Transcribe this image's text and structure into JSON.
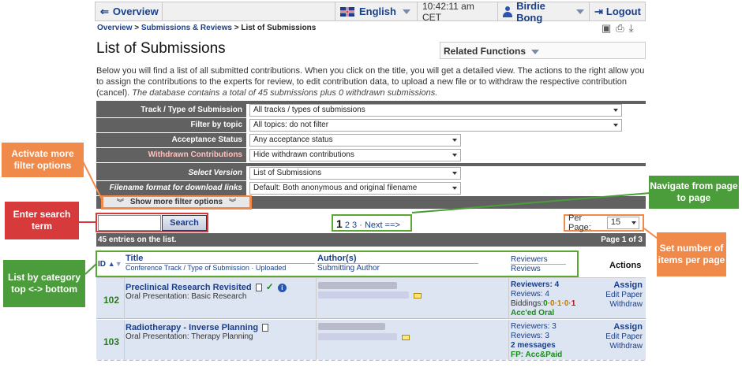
{
  "topbar": {
    "overview": "Overview",
    "language": "English",
    "time": "10:42:11 am CET",
    "user": "Birdie Bong",
    "logout": "Logout"
  },
  "breadcrumb": {
    "overview": "Overview",
    "submissions": "Submissions & Reviews",
    "current": "List of Submissions"
  },
  "page": {
    "title": "List of Submissions",
    "related_functions": "Related Functions",
    "intro": "Below you will find a list of all submitted contributions. When you click on the title, you will get a detailed view. The actions to the right allow you to assign the contributions to the experts for review, to edit contribution data, to upload a new file or to withdraw the respective contribution (cancel).",
    "intro_italic": "The database contains a total of 45 submissions plus 0 withdrawn submissions."
  },
  "filters": {
    "track_label": "Track / Type of Submission",
    "track_value": "All tracks / types of submissions",
    "topic_label": "Filter by topic",
    "topic_value": "All topics: do not filter",
    "acceptance_label": "Acceptance Status",
    "acceptance_value": "Any acceptance status",
    "withdrawn_label": "Withdrawn Contributions",
    "withdrawn_value": "Hide withdrawn contributions",
    "version_label": "Select Version",
    "version_value": "List of Submissions",
    "filename_label": "Filename format for download links",
    "filename_value": "Default: Both anonymous and original filename",
    "more_options": "Show more filter options"
  },
  "search": {
    "button": "Search",
    "value": ""
  },
  "pager": {
    "current": "1",
    "p2": "2",
    "p3": "3",
    "next": "· Next ==>"
  },
  "perpage": {
    "label": "Per Page:",
    "value": "15"
  },
  "list": {
    "entries": "45 entries on the list.",
    "page_of": "Page 1 of 3"
  },
  "table_header": {
    "id": "ID",
    "title": "Title",
    "title_sub": "Conference Track / Type of Submission · Uploaded",
    "authors": "Author(s)",
    "authors_sub": "Submitting Author",
    "reviewers": "Reviewers",
    "reviews": "Reviews",
    "actions": "Actions"
  },
  "rows": [
    {
      "id": "102",
      "title": "Preclinical Research Revisited",
      "track": "Oral Presentation: Basic Research",
      "reviewers": "Reviewers: 4",
      "reviews": "Reviews: 4",
      "biddings_label": "Biddings:",
      "biddings_a": "0",
      "biddings_b": "·0·1·0·",
      "biddings_c": "1",
      "status": "Acc'ed Oral",
      "assign": "Assign",
      "edit": "Edit Paper",
      "withdraw": "Withdraw"
    },
    {
      "id": "103",
      "title": "Radiotherapy - Inverse Planning",
      "track": "Oral Presentation: Therapy Planning",
      "reviewers": "Reviewers: 3",
      "reviews": "Reviews: 3",
      "messages": "2 messages",
      "status": "FP: Acc&Paid",
      "assign": "Assign",
      "edit": "Edit Paper",
      "withdraw": "Withdraw"
    }
  ],
  "annotations": {
    "more_filter": "Activate more filter options",
    "search_term": "Enter search term",
    "category": "List by category top <-> bottom",
    "navigate": "Navigate from page to page",
    "items_per_page": "Set number of items per page"
  },
  "colors": {
    "orange": "#f08a4b",
    "red": "#d63a3a",
    "green": "#4a9d3a",
    "filter_bar": "#616161",
    "row_bg": "#dde5f2"
  }
}
